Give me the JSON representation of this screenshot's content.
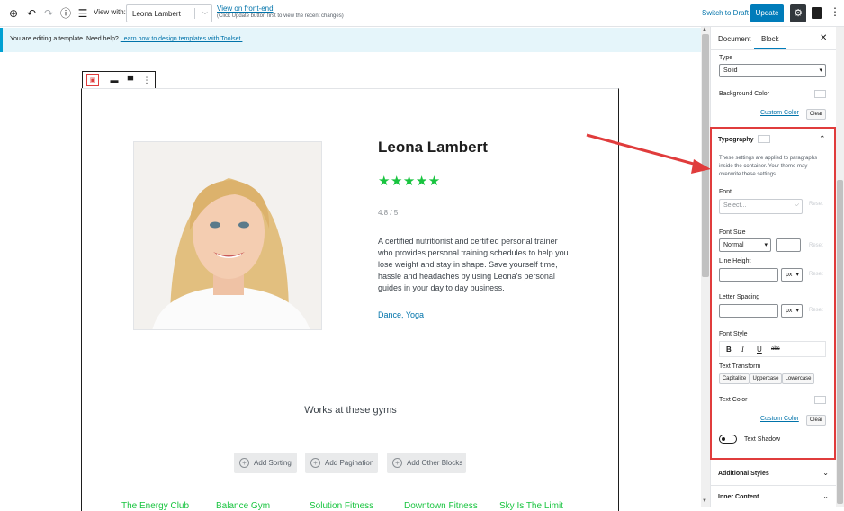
{
  "colors": {
    "accent": "#007cba",
    "star_green": "#18c43f",
    "annotation_red": "#e03c3c",
    "link": "#0073aa"
  },
  "topbar": {
    "view_with_label": "View with:",
    "view_with_value": "Leona Lambert",
    "view_link": "View on front-end",
    "view_hint": "(Click Update button first to view the recent changes)",
    "switch_to_draft": "Switch to Draft",
    "update": "Update"
  },
  "notice": {
    "text": "You are editing a template. Need help?",
    "link": "Learn how to design templates with Toolset."
  },
  "profile": {
    "name": "Leona Lambert",
    "stars": "★★★★★",
    "rating": "4.8 / 5",
    "description": "A certified nutritionist and certified personal trainer who provides personal training schedules to help you lose weight and stay in shape. Save yourself time, hassle and headaches by using Leona's personal guides in your day to day business.",
    "tags": "Dance, Yoga"
  },
  "gyms": {
    "heading": "Works at these gyms",
    "add_sorting": "Add Sorting",
    "add_pagination": "Add Pagination",
    "add_other": "Add Other Blocks",
    "items": [
      "The Energy Club",
      "Balance Gym",
      "Solution Fitness",
      "Downtown Fitness",
      "Sky Is The Limit"
    ]
  },
  "sidebar": {
    "tabs": [
      "Document",
      "Block"
    ],
    "type_label": "Type",
    "type_value": "Solid",
    "bg_color_label": "Background Color",
    "custom_color": "Custom Color",
    "clear": "Clear",
    "typography": {
      "title": "Typography",
      "help": "These settings are applied to paragraphs inside the container. Your theme may overwrite these settings.",
      "font_label": "Font",
      "font_placeholder": "Select...",
      "font_size_label": "Font Size",
      "font_size_value": "Normal",
      "line_height_label": "Line Height",
      "letter_spacing_label": "Letter Spacing",
      "unit": "px",
      "font_style_label": "Font Style",
      "text_transform_label": "Text Transform",
      "transforms": [
        "Capitalize",
        "Uppercase",
        "Lowercase"
      ],
      "text_color_label": "Text Color",
      "custom_color": "Custom Color",
      "clear": "Clear",
      "text_shadow": "Text Shadow",
      "reset": "Reset"
    },
    "sections": [
      "Additional Styles",
      "Inner Content"
    ]
  }
}
